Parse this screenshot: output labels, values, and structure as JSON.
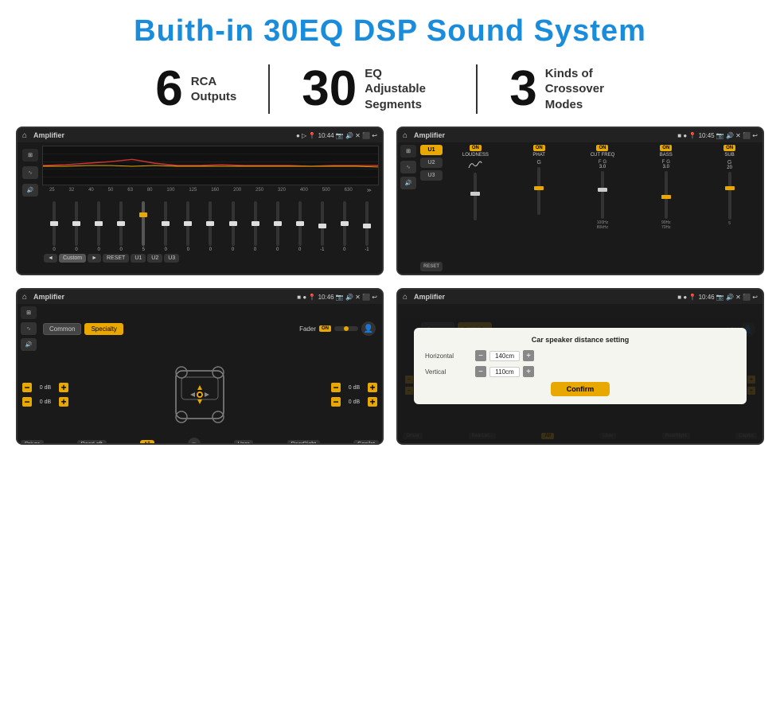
{
  "header": {
    "title": "Buith-in 30EQ DSP Sound System"
  },
  "stats": [
    {
      "number": "6",
      "desc": "RCA\nOutputs"
    },
    {
      "number": "30",
      "desc": "EQ Adjustable\nSegments"
    },
    {
      "number": "3",
      "desc": "Kinds of\nCrossover Modes"
    }
  ],
  "screens": [
    {
      "id": "eq-screen",
      "statusBar": {
        "title": "Amplifier",
        "time": "10:44"
      }
    },
    {
      "id": "crossover-screen",
      "statusBar": {
        "title": "Amplifier",
        "time": "10:45"
      }
    },
    {
      "id": "fader-screen",
      "statusBar": {
        "title": "Amplifier",
        "time": "10:46"
      }
    },
    {
      "id": "dialog-screen",
      "statusBar": {
        "title": "Amplifier",
        "time": "10:46"
      },
      "dialog": {
        "title": "Car speaker distance setting",
        "horizontal_label": "Horizontal",
        "horizontal_value": "140cm",
        "vertical_label": "Vertical",
        "vertical_value": "110cm",
        "confirm_label": "Confirm"
      }
    }
  ],
  "eq": {
    "freqs": [
      "25",
      "32",
      "40",
      "50",
      "63",
      "80",
      "100",
      "125",
      "160",
      "200",
      "250",
      "320",
      "400",
      "500",
      "630"
    ],
    "values": [
      "0",
      "0",
      "0",
      "0",
      "5",
      "0",
      "0",
      "0",
      "0",
      "0",
      "0",
      "0",
      "-1",
      "0",
      "-1"
    ],
    "presets": [
      "Custom",
      "RESET",
      "U1",
      "U2",
      "U3"
    ]
  },
  "crossover": {
    "presets": [
      "U1",
      "U2",
      "U3"
    ],
    "params": [
      "LOUDNESS",
      "PHAT",
      "CUT FREQ",
      "BASS",
      "SUB"
    ],
    "reset_label": "RESET"
  },
  "fader": {
    "tabs": [
      "Common",
      "Specialty"
    ],
    "fader_label": "Fader",
    "on_label": "ON",
    "bottom_btns": [
      "Driver",
      "RearLeft",
      "All",
      "User",
      "RearRight",
      "Copilot"
    ],
    "vol_values": [
      "0 dB",
      "0 dB",
      "0 dB",
      "0 dB"
    ]
  }
}
